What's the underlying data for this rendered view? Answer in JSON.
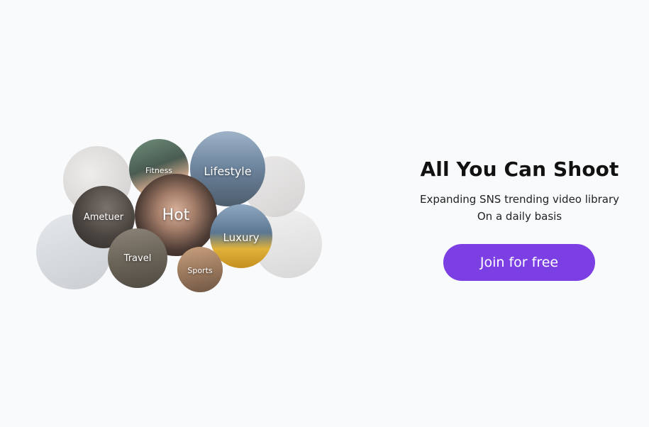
{
  "hero": {
    "title": "All You Can Shoot",
    "subtitle_line1": "Expanding SNS trending video library",
    "subtitle_line2": "On a daily basis",
    "cta_label": "Join for free"
  },
  "categories": {
    "fitness": "Fitness",
    "lifestyle": "Lifestyle",
    "amateur": "Ametuer",
    "hot": "Hot",
    "luxury": "Luxury",
    "travel": "Travel",
    "sports": "Sports"
  },
  "colors": {
    "accent": "#7b3fe4",
    "background": "#f9fafc"
  }
}
